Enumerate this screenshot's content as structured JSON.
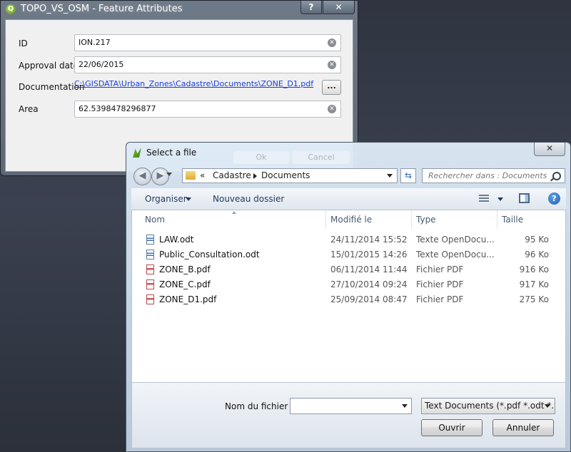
{
  "qgis_dialog": {
    "title": "TOPO_VS_OSM - Feature Attributes",
    "app_icon_glyph": "Q",
    "help_label": "?",
    "close_label": "✕",
    "fields": [
      {
        "label": "ID",
        "value": "ION.217"
      },
      {
        "label": "Approval date",
        "value": "22/06/2015"
      },
      {
        "label": "Documentation",
        "value": "C:\\GISDATA\\Urban_Zones\\Cadastre\\Documents\\ZONE_D1.pdf"
      },
      {
        "label": "Area",
        "value": "62.5398478296877"
      }
    ],
    "browse_label": "...",
    "clear_glyph": "✕",
    "ok_label": "Ok",
    "cancel_label": "Cancel"
  },
  "file_dialog": {
    "title": "Select a file",
    "close_label": "✕",
    "back_glyph": "◀",
    "forward_glyph": "▶",
    "address": {
      "prefix": "«",
      "segments": [
        "Cadastre",
        "Documents"
      ]
    },
    "refresh_glyph": "⇆",
    "search_placeholder": "Rechercher dans : Documents",
    "toolbar": {
      "organize": "Organiser",
      "new_folder": "Nouveau dossier",
      "help_glyph": "?"
    },
    "columns": {
      "name": "Nom",
      "modified": "Modifié le",
      "type": "Type",
      "size": "Taille"
    },
    "files": [
      {
        "name": "LAW.odt",
        "modified": "24/11/2014 15:52",
        "type": "Texte OpenDocu...",
        "size": "95 Ko",
        "kind": "odt"
      },
      {
        "name": "Public_Consultation.odt",
        "modified": "15/01/2015 14:26",
        "type": "Texte OpenDocu...",
        "size": "96 Ko",
        "kind": "odt"
      },
      {
        "name": "ZONE_B.pdf",
        "modified": "06/11/2014 11:44",
        "type": "Fichier PDF",
        "size": "916 Ko",
        "kind": "pdf"
      },
      {
        "name": "ZONE_C.pdf",
        "modified": "27/10/2014 09:24",
        "type": "Fichier PDF",
        "size": "917 Ko",
        "kind": "pdf"
      },
      {
        "name": "ZONE_D1.pdf",
        "modified": "25/09/2014 08:47",
        "type": "Fichier PDF",
        "size": "275 Ko",
        "kind": "pdf"
      }
    ],
    "filename_label": "Nom du fichier :",
    "filename_value": "",
    "filter_value": "Text Documents (*.pdf *.odt *.t",
    "open_label": "Ouvrir",
    "cancel_label": "Annuler"
  }
}
